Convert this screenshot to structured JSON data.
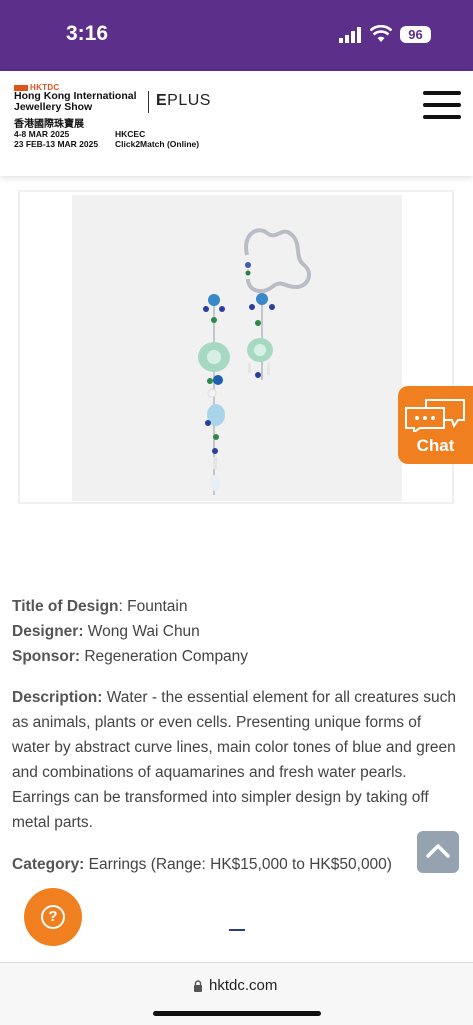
{
  "status_bar": {
    "time": "3:16",
    "battery": "96"
  },
  "header": {
    "brand": "HKTDC",
    "show_name": "Hong Kong International Jewellery Show",
    "show_chinese": "香港國際珠寶展",
    "eplus": "PLUS",
    "dates_line1": "4-8 MAR 2025",
    "dates_line2": "23 FEB-13 MAR 2025",
    "venue_line1": "HKCEC",
    "venue_line2": "Click2Match (Online)"
  },
  "design": {
    "title_label": "Title of Design",
    "title_value": ": Fountain",
    "designer_label": "Designer:",
    "designer_value": " Wong Wai Chun",
    "sponsor_label": "Sponsor:",
    "sponsor_value": " Regeneration Company",
    "description_label": "Description:",
    "description_value": " Water - the essential element for all creatures such as animals, plants or even cells. Presenting unique forms of water by abstract curve lines, main color tones of blue and green and combinations of aquamarines and fresh water pearls. Earrings can be transformed into simpler design by taking off metal parts.",
    "category_label": "Category:",
    "category_value": " Earrings (Range: HK$15,000 to HK$50,000)"
  },
  "chat": {
    "label": "Chat"
  },
  "help": {
    "symbol": "?"
  },
  "url_bar": {
    "url": "hktdc.com"
  },
  "colors": {
    "status_bar": "#5b2f8a",
    "accent_orange": "#f0801f",
    "brand_orange": "#e0531b"
  },
  "icons": [
    "signal-icon",
    "wifi-icon",
    "menu-icon",
    "chat-bubbles-icon",
    "chevron-up-icon",
    "question-icon",
    "lock-icon"
  ]
}
